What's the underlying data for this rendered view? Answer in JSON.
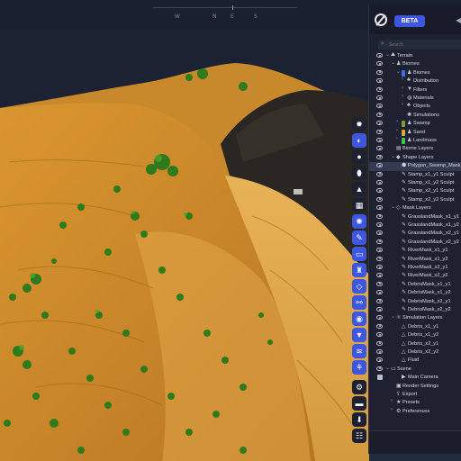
{
  "compass": {
    "directions": [
      "W",
      "N",
      "E",
      "S"
    ]
  },
  "header": {
    "beta_label": "BETA"
  },
  "search": {
    "placeholder": "Search"
  },
  "toolbar": {
    "buttons": [
      {
        "name": "light-icon",
        "glyph": "✹",
        "style": "dark"
      },
      {
        "name": "globe-icon",
        "glyph": "◐",
        "style": "blue"
      },
      {
        "name": "sphere-icon",
        "glyph": "●",
        "style": "dark"
      },
      {
        "name": "drop-icon",
        "glyph": "⬮",
        "style": "dark"
      },
      {
        "name": "triangle-icon",
        "glyph": "▲",
        "style": "dark"
      },
      {
        "name": "grid-icon",
        "glyph": "▦",
        "style": "dark"
      },
      {
        "name": "settings-icon",
        "glyph": "✺",
        "style": "blue"
      },
      {
        "name": "brush-icon",
        "glyph": "✎",
        "style": "blue"
      },
      {
        "name": "ruler-icon",
        "glyph": "▭",
        "style": "blue"
      },
      {
        "name": "stamp-icon",
        "glyph": "♜",
        "style": "blue"
      },
      {
        "name": "mask-icon",
        "glyph": "◇",
        "style": "blue"
      },
      {
        "name": "nodes-icon",
        "glyph": "⚯",
        "style": "blue"
      },
      {
        "name": "view-icon",
        "glyph": "◉",
        "style": "blue"
      },
      {
        "name": "filter-icon",
        "glyph": "▼",
        "style": "blue"
      },
      {
        "name": "layers-icon",
        "glyph": "≋",
        "style": "blue"
      },
      {
        "name": "share-icon",
        "glyph": "⚘",
        "style": "blue"
      },
      {
        "name": "gear-icon",
        "glyph": "⚙",
        "style": "dark"
      },
      {
        "name": "folder-icon",
        "glyph": "▬",
        "style": "dark"
      },
      {
        "name": "download-icon",
        "glyph": "⬇",
        "style": "dark"
      },
      {
        "name": "stats-icon",
        "glyph": "☷",
        "style": "dark"
      }
    ]
  },
  "tree": [
    {
      "label": "Terrain",
      "indent": 0,
      "caret": "⌄",
      "icon": "⛰",
      "vis": "eye"
    },
    {
      "label": "Biomes",
      "indent": 1,
      "caret": "⌄",
      "icon": "♟",
      "vis": "eye"
    },
    {
      "label": "Biomes",
      "indent": 2,
      "caret": "⌄",
      "icon": "",
      "swatch": "#3f6ee8",
      "vis": "eye"
    },
    {
      "label": "Distribution",
      "indent": 3,
      "caret": "›",
      "icon": "♣",
      "vis": "eye"
    },
    {
      "label": "Filters",
      "indent": 3,
      "caret": "›",
      "icon": "▼",
      "vis": "eye"
    },
    {
      "label": "Materials",
      "indent": 3,
      "caret": "›",
      "icon": "◍",
      "vis": "eye"
    },
    {
      "label": "Objects",
      "indent": 3,
      "caret": "›",
      "icon": "♣",
      "vis": "eye"
    },
    {
      "label": "Simulations",
      "indent": 3,
      "caret": "",
      "icon": "✺",
      "vis": "eye"
    },
    {
      "label": "Swamp",
      "indent": 2,
      "caret": "›",
      "icon": "",
      "swatch": "#8a9a3a",
      "vis": "eye"
    },
    {
      "label": "Sand",
      "indent": 2,
      "caret": "›",
      "icon": "",
      "swatch": "#e0a43a",
      "vis": "eye"
    },
    {
      "label": "Landmass",
      "indent": 2,
      "caret": "›",
      "icon": "",
      "swatch": "#3cc84a",
      "vis": "eye"
    },
    {
      "label": "Biome Layers",
      "indent": 1,
      "caret": "",
      "icon": "▤",
      "vis": "eye"
    },
    {
      "label": "Shape Layers",
      "indent": 1,
      "caret": "⌄",
      "icon": "◆",
      "vis": "eye"
    },
    {
      "label": "Polygon_Swamp_Mask",
      "indent": 2,
      "caret": "",
      "icon": "⬢",
      "vis": "eye",
      "selected": true
    },
    {
      "label": "Stamp_x1_y1 Sculpt",
      "indent": 2,
      "caret": "",
      "icon": "✎",
      "vis": "eye"
    },
    {
      "label": "Stamp_x1_y2 Sculpt",
      "indent": 2,
      "caret": "",
      "icon": "✎",
      "vis": "eye"
    },
    {
      "label": "Stamp_x2_y1 Sculpt",
      "indent": 2,
      "caret": "",
      "icon": "✎",
      "vis": "eye"
    },
    {
      "label": "Stamp_x2_y2 Sculpt",
      "indent": 2,
      "caret": "",
      "icon": "✎",
      "vis": "eye"
    },
    {
      "label": "Mask Layers",
      "indent": 1,
      "caret": "⌄",
      "icon": "◇",
      "vis": "eye"
    },
    {
      "label": "GrasslandMask_x1_y1",
      "indent": 2,
      "caret": "",
      "icon": "✎",
      "vis": "eye"
    },
    {
      "label": "GrasslandMask_x1_y2",
      "indent": 2,
      "caret": "",
      "icon": "✎",
      "vis": "eye"
    },
    {
      "label": "GrasslandMask_x2_y1",
      "indent": 2,
      "caret": "",
      "icon": "✎",
      "vis": "eye"
    },
    {
      "label": "GrasslandMask_x2_y2",
      "indent": 2,
      "caret": "",
      "icon": "✎",
      "vis": "eye"
    },
    {
      "label": "RiverMask_x1_y1",
      "indent": 2,
      "caret": "",
      "icon": "✎",
      "vis": "eye"
    },
    {
      "label": "RiverMask_x1_y2",
      "indent": 2,
      "caret": "",
      "icon": "✎",
      "vis": "eye"
    },
    {
      "label": "RiverMask_x2_y1",
      "indent": 2,
      "caret": "",
      "icon": "✎",
      "vis": "eye"
    },
    {
      "label": "RiverMask_x2_y2",
      "indent": 2,
      "caret": "",
      "icon": "✎",
      "vis": "eye"
    },
    {
      "label": "DebrisMask_x1_y1",
      "indent": 2,
      "caret": "",
      "icon": "✎",
      "vis": "eye"
    },
    {
      "label": "DebrisMask_x1_y2",
      "indent": 2,
      "caret": "",
      "icon": "✎",
      "vis": "eye"
    },
    {
      "label": "DebrisMask_x2_y1",
      "indent": 2,
      "caret": "",
      "icon": "✎",
      "vis": "eye"
    },
    {
      "label": "DebrisMask_x2_y2",
      "indent": 2,
      "caret": "",
      "icon": "✎",
      "vis": "eye"
    },
    {
      "label": "Simulation Layers",
      "indent": 1,
      "caret": "⌄",
      "icon": "⚛",
      "vis": "eye"
    },
    {
      "label": "Debris_x1_y1",
      "indent": 2,
      "caret": "",
      "icon": "△",
      "vis": "eye"
    },
    {
      "label": "Debris_x1_y2",
      "indent": 2,
      "caret": "",
      "icon": "△",
      "vis": "eye"
    },
    {
      "label": "Debris_x2_y1",
      "indent": 2,
      "caret": "",
      "icon": "△",
      "vis": "eye"
    },
    {
      "label": "Debris_x2_y2",
      "indent": 2,
      "caret": "",
      "icon": "△",
      "vis": "eye"
    },
    {
      "label": "Fluid",
      "indent": 2,
      "caret": "",
      "icon": "△",
      "vis": "eye"
    },
    {
      "label": "Scene",
      "indent": 0,
      "caret": "⌄",
      "icon": "▭",
      "vis": "eye"
    },
    {
      "label": "Main Camera",
      "indent": 2,
      "caret": "",
      "icon": "▶",
      "vis": "lock"
    },
    {
      "label": "Render Settings",
      "indent": 1,
      "caret": "",
      "icon": "▣",
      "vis": ""
    },
    {
      "label": "Export",
      "indent": 1,
      "caret": "",
      "icon": "⇪",
      "vis": ""
    },
    {
      "label": "Presets",
      "indent": 1,
      "caret": "›",
      "icon": "★",
      "vis": ""
    },
    {
      "label": "Preferences",
      "indent": 1,
      "caret": "›",
      "icon": "⚙",
      "vis": ""
    }
  ]
}
